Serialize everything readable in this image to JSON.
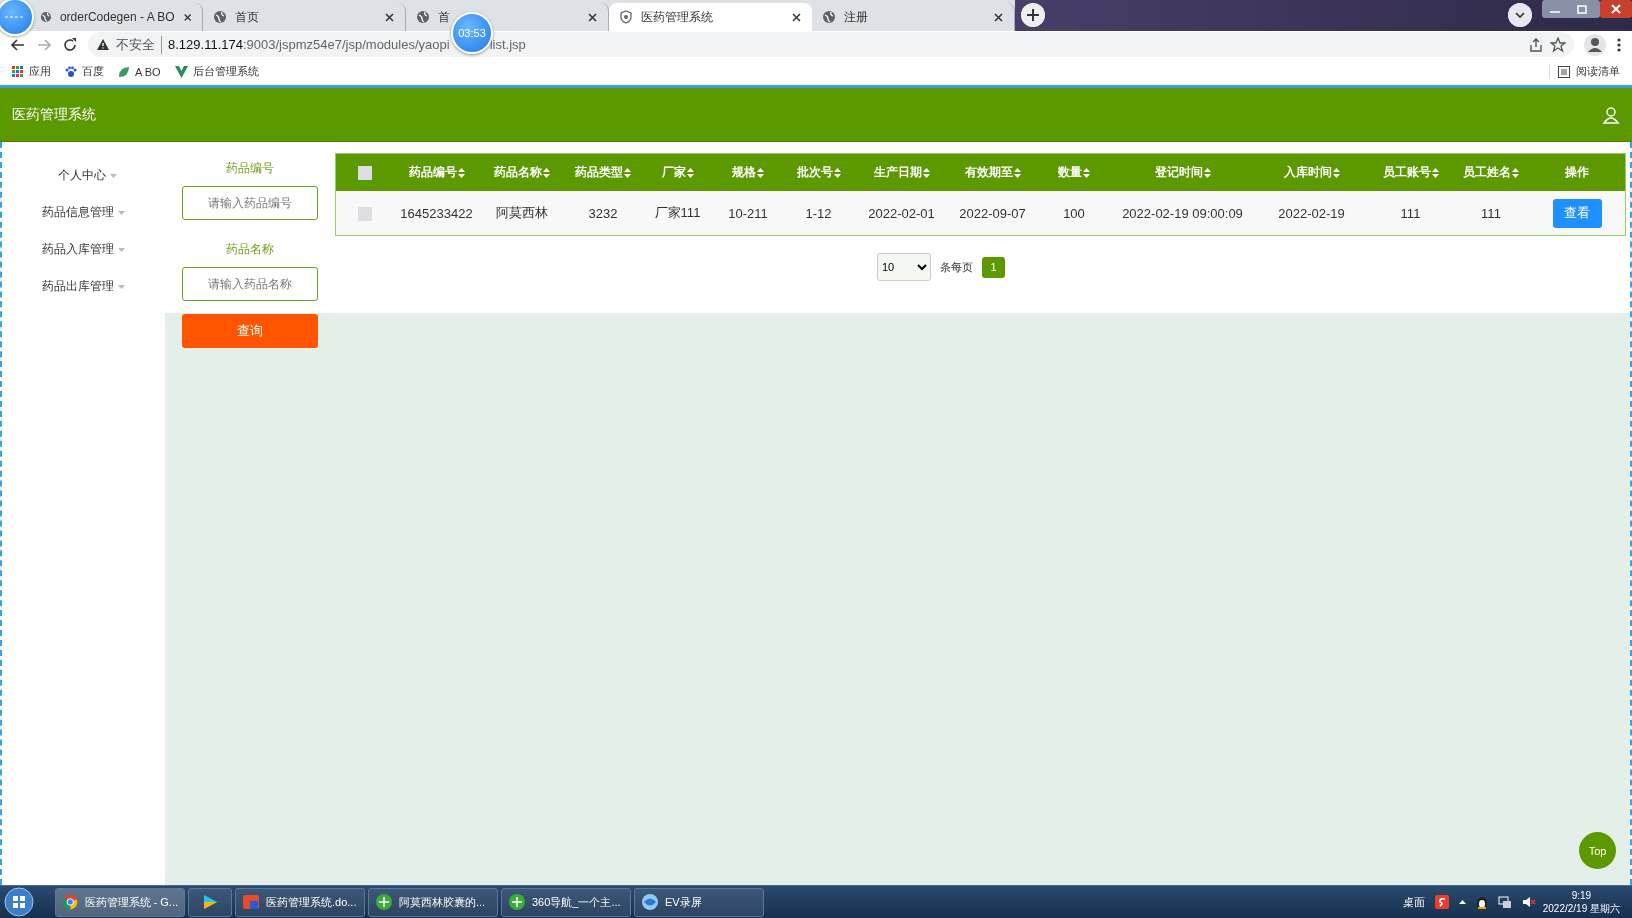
{
  "browser": {
    "tabs": [
      {
        "title": "orderCodegen - A BO",
        "selected": false
      },
      {
        "title": "首页",
        "selected": false
      },
      {
        "title": "首",
        "selected": false
      },
      {
        "title": "医药管理系统",
        "selected": true
      },
      {
        "title": "注册",
        "selected": false
      }
    ],
    "security_label": "不安全",
    "url_host": "8.129.11.174",
    "url_path": ":9003/jspmz54e7/jsp/modules/yaopi",
    "url_end": "list.jsp",
    "recorder_time": "03:53",
    "bookmarks": [
      "应用",
      "百度",
      "A BO",
      "后台管理系统"
    ],
    "reading_list": "阅读清单"
  },
  "app": {
    "title": "医药管理系统"
  },
  "sidebar": {
    "items": [
      {
        "label": "个人中心"
      },
      {
        "label": "药品信息管理"
      },
      {
        "label": "药品入库管理"
      },
      {
        "label": "药品出库管理"
      }
    ]
  },
  "search": {
    "fields": [
      {
        "label": "药品编号",
        "placeholder": "请输入药品编号"
      },
      {
        "label": "药品名称",
        "placeholder": "请输入药品名称"
      }
    ],
    "button": "查询"
  },
  "table": {
    "select_all_checked": false,
    "columns": [
      {
        "label": "药品编号",
        "sortable": true
      },
      {
        "label": "药品名称",
        "sortable": true
      },
      {
        "label": "药品类型",
        "sortable": true
      },
      {
        "label": "厂家",
        "sortable": true
      },
      {
        "label": "规格",
        "sortable": true
      },
      {
        "label": "批次号",
        "sortable": true
      },
      {
        "label": "生产日期",
        "sortable": true
      },
      {
        "label": "有效期至",
        "sortable": true
      },
      {
        "label": "数量",
        "sortable": true
      },
      {
        "label": "登记时间",
        "sortable": true
      },
      {
        "label": "入库时间",
        "sortable": true
      },
      {
        "label": "员工账号",
        "sortable": true
      },
      {
        "label": "员工姓名",
        "sortable": true
      },
      {
        "label": "操作",
        "sortable": false
      }
    ],
    "rows": [
      {
        "selected": false,
        "cells": [
          "1645233422",
          "阿莫西林",
          "3232",
          "厂家111",
          "10-211",
          "1-12",
          "2022-02-01",
          "2022-09-07",
          "100",
          "2022-02-19 09:00:09",
          "2022-02-19",
          "111",
          "111"
        ],
        "action": "查看"
      }
    ]
  },
  "pagination": {
    "page_size": "10",
    "per_page_label": "条每页",
    "pages": [
      {
        "label": "1",
        "selected": true
      }
    ]
  },
  "top_button": "Top",
  "taskbar": {
    "items": [
      {
        "kind": "window",
        "label": "医药管理系统 - G...",
        "selected": true
      },
      {
        "kind": "pinned",
        "selected": false
      },
      {
        "kind": "window",
        "label": "医药管理系统.do...",
        "selected": false
      },
      {
        "kind": "window",
        "label": "阿莫西林胶囊的...",
        "selected": false
      },
      {
        "kind": "window",
        "label": "360导航_一个主...",
        "selected": false
      },
      {
        "kind": "window",
        "label": "EV录屏",
        "selected": false
      }
    ],
    "desktop": "桌面",
    "time": "9:19",
    "date": "2022/2/19 星期六"
  }
}
